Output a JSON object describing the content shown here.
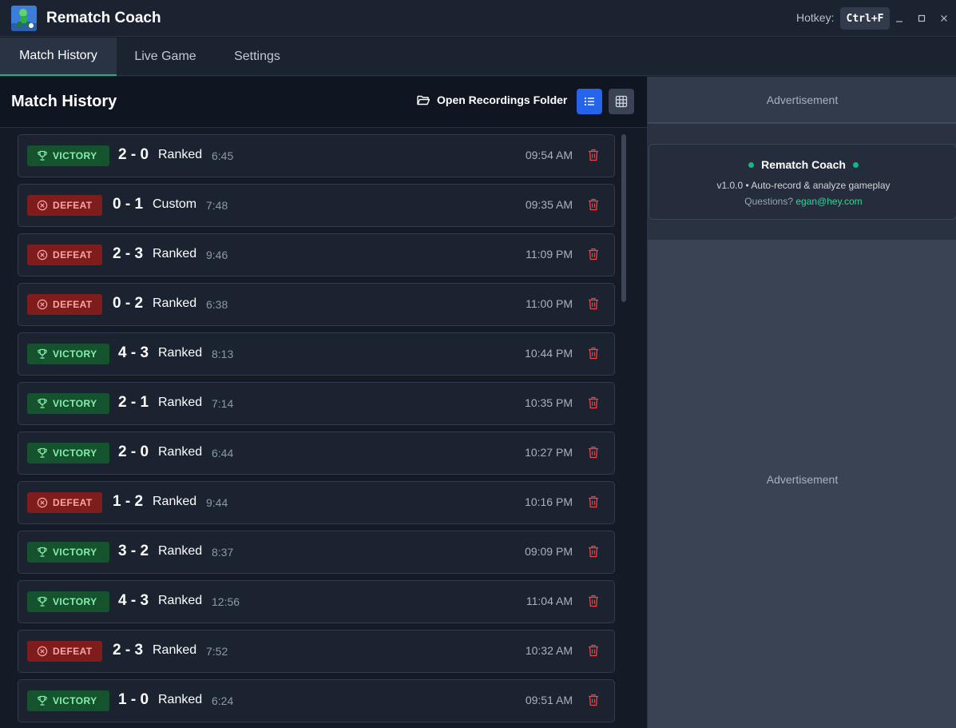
{
  "app": {
    "title": "Rematch Coach",
    "hotkey_label": "Hotkey:",
    "hotkey": "Ctrl+F"
  },
  "tabs": [
    {
      "label": "Match History",
      "active": true
    },
    {
      "label": "Live Game",
      "active": false
    },
    {
      "label": "Settings",
      "active": false
    }
  ],
  "main": {
    "title": "Match History",
    "open_folder_label": "Open Recordings Folder",
    "active_view": "list"
  },
  "matches": [
    {
      "result": "VICTORY",
      "score": "2 - 0",
      "mode": "Ranked",
      "duration": "6:45",
      "time": "09:54 AM"
    },
    {
      "result": "DEFEAT",
      "score": "0 - 1",
      "mode": "Custom",
      "duration": "7:48",
      "time": "09:35 AM"
    },
    {
      "result": "DEFEAT",
      "score": "2 - 3",
      "mode": "Ranked",
      "duration": "9:46",
      "time": "11:09 PM"
    },
    {
      "result": "DEFEAT",
      "score": "0 - 2",
      "mode": "Ranked",
      "duration": "6:38",
      "time": "11:00 PM"
    },
    {
      "result": "VICTORY",
      "score": "4 - 3",
      "mode": "Ranked",
      "duration": "8:13",
      "time": "10:44 PM"
    },
    {
      "result": "VICTORY",
      "score": "2 - 1",
      "mode": "Ranked",
      "duration": "7:14",
      "time": "10:35 PM"
    },
    {
      "result": "VICTORY",
      "score": "2 - 0",
      "mode": "Ranked",
      "duration": "6:44",
      "time": "10:27 PM"
    },
    {
      "result": "DEFEAT",
      "score": "1 - 2",
      "mode": "Ranked",
      "duration": "9:44",
      "time": "10:16 PM"
    },
    {
      "result": "VICTORY",
      "score": "3 - 2",
      "mode": "Ranked",
      "duration": "8:37",
      "time": "09:09 PM"
    },
    {
      "result": "VICTORY",
      "score": "4 - 3",
      "mode": "Ranked",
      "duration": "12:56",
      "time": "11:04 AM"
    },
    {
      "result": "DEFEAT",
      "score": "2 - 3",
      "mode": "Ranked",
      "duration": "7:52",
      "time": "10:32 AM"
    },
    {
      "result": "VICTORY",
      "score": "1 - 0",
      "mode": "Ranked",
      "duration": "6:24",
      "time": "09:51 AM"
    }
  ],
  "sidebar": {
    "ad_top": "Advertisement",
    "ad_mid": "Advertisement",
    "info": {
      "title": "Rematch Coach",
      "version_line": "v1.0.0 • Auto-record & analyze gameplay",
      "questions_prefix": "Questions?",
      "email": "egan@hey.com"
    }
  },
  "colors": {
    "accent": "#10b981",
    "victory": "#14532d",
    "defeat": "#7f1d1d",
    "primary": "#2563eb"
  },
  "icons": {
    "victory": "trophy-icon",
    "defeat": "x-circle-icon",
    "delete": "trash-icon",
    "folder": "folder-open-icon",
    "list": "list-icon",
    "grid": "grid-icon"
  }
}
